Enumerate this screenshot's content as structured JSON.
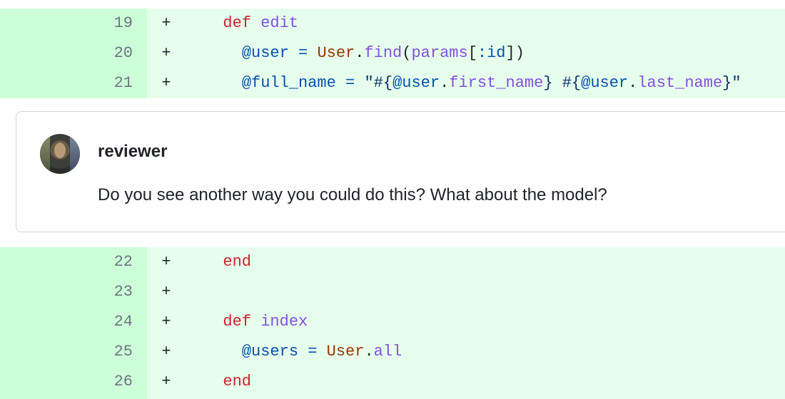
{
  "diff_top": {
    "lines": [
      {
        "num": "19",
        "marker": "+",
        "tokens": [
          {
            "t": "  ",
            "c": ""
          },
          {
            "t": "def",
            "c": "kw"
          },
          {
            "t": " ",
            "c": ""
          },
          {
            "t": "edit",
            "c": "fn"
          }
        ]
      },
      {
        "num": "20",
        "marker": "+",
        "tokens": [
          {
            "t": "    ",
            "c": ""
          },
          {
            "t": "@user",
            "c": "iv"
          },
          {
            "t": " ",
            "c": ""
          },
          {
            "t": "=",
            "c": "op"
          },
          {
            "t": " ",
            "c": ""
          },
          {
            "t": "User",
            "c": "cls"
          },
          {
            "t": ".",
            "c": ""
          },
          {
            "t": "find",
            "c": "fn"
          },
          {
            "t": "(",
            "c": ""
          },
          {
            "t": "params",
            "c": "fn"
          },
          {
            "t": "[",
            "c": ""
          },
          {
            "t": ":id",
            "c": "iv"
          },
          {
            "t": "])",
            "c": ""
          }
        ]
      },
      {
        "num": "21",
        "marker": "+",
        "tokens": [
          {
            "t": "    ",
            "c": ""
          },
          {
            "t": "@full_name",
            "c": "iv"
          },
          {
            "t": " ",
            "c": ""
          },
          {
            "t": "=",
            "c": "op"
          },
          {
            "t": " ",
            "c": ""
          },
          {
            "t": "\"#{",
            "c": "str"
          },
          {
            "t": "@user",
            "c": "iv"
          },
          {
            "t": ".",
            "c": ""
          },
          {
            "t": "first_name",
            "c": "fn"
          },
          {
            "t": "} #{",
            "c": "str"
          },
          {
            "t": "@user",
            "c": "iv"
          },
          {
            "t": ".",
            "c": ""
          },
          {
            "t": "last_name",
            "c": "fn"
          },
          {
            "t": "}\"",
            "c": "str"
          }
        ]
      }
    ]
  },
  "comment": {
    "username": "reviewer",
    "body": "Do you see another way you could do this? What about the model?",
    "avatar_icon": "user-avatar"
  },
  "diff_bottom": {
    "lines": [
      {
        "num": "22",
        "marker": "+",
        "tokens": [
          {
            "t": "  ",
            "c": ""
          },
          {
            "t": "end",
            "c": "kw"
          }
        ]
      },
      {
        "num": "23",
        "marker": "+",
        "tokens": []
      },
      {
        "num": "24",
        "marker": "+",
        "tokens": [
          {
            "t": "  ",
            "c": ""
          },
          {
            "t": "def",
            "c": "kw"
          },
          {
            "t": " ",
            "c": ""
          },
          {
            "t": "index",
            "c": "fn"
          }
        ]
      },
      {
        "num": "25",
        "marker": "+",
        "tokens": [
          {
            "t": "    ",
            "c": ""
          },
          {
            "t": "@users",
            "c": "iv"
          },
          {
            "t": " ",
            "c": ""
          },
          {
            "t": "=",
            "c": "op"
          },
          {
            "t": " ",
            "c": ""
          },
          {
            "t": "User",
            "c": "cls"
          },
          {
            "t": ".",
            "c": ""
          },
          {
            "t": "all",
            "c": "fn"
          }
        ]
      },
      {
        "num": "26",
        "marker": "+",
        "tokens": [
          {
            "t": "  ",
            "c": ""
          },
          {
            "t": "end",
            "c": "kw"
          }
        ]
      }
    ]
  },
  "colors": {
    "gutter_added": "#cdffd8",
    "code_added": "#e6ffec",
    "keyword": "#cf222e",
    "function": "#8250df",
    "ivar": "#0550ae",
    "constant": "#953800"
  }
}
